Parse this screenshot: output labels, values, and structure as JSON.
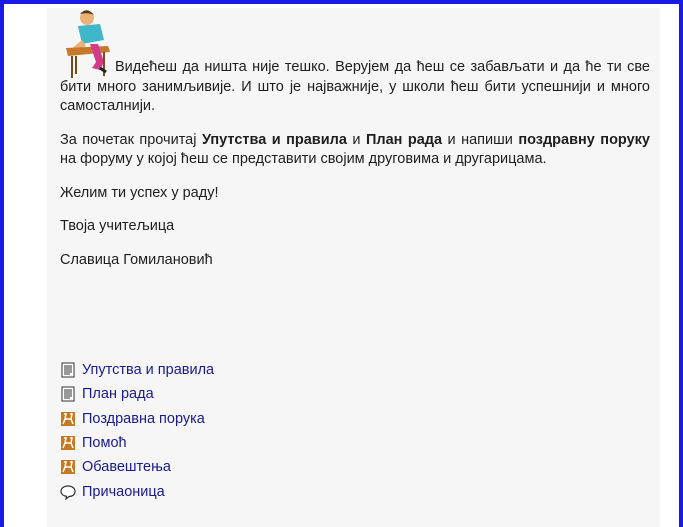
{
  "intro": {
    "line1": "Видећеш да ништа није тешко. Верујем да ћеш се забављати и",
    "rest": "да ће ти све бити много занимљивије. И што је најважније, у школи ћеш бити успешнији и много самосталнији."
  },
  "para2": {
    "t1": "За почетак прочитај ",
    "b1": "Упутства и правила",
    "t2": " и ",
    "b2": "План рада",
    "t3": " и напиши ",
    "b3": "поздравну поруку",
    "t4": " на форуму у којој ћеш се представити својим друговима и другарицама."
  },
  "wish": "Желим ти успех у раду!",
  "sign_role": "Твоја учитељица",
  "sign_name": "Славица Гомилановић",
  "links": [
    {
      "label": "Упутства и правила",
      "icon": "document-icon"
    },
    {
      "label": "План рада",
      "icon": "document-icon"
    },
    {
      "label": "Поздравна порука",
      "icon": "forum-icon"
    },
    {
      "label": "Помоћ",
      "icon": "forum-icon"
    },
    {
      "label": "Обавештења",
      "icon": "forum-icon"
    },
    {
      "label": "Причаоница",
      "icon": "chat-icon"
    }
  ],
  "colors": {
    "border": "#1a1ae6",
    "link": "#1a1a8c",
    "panel": "#f6f6f6"
  }
}
